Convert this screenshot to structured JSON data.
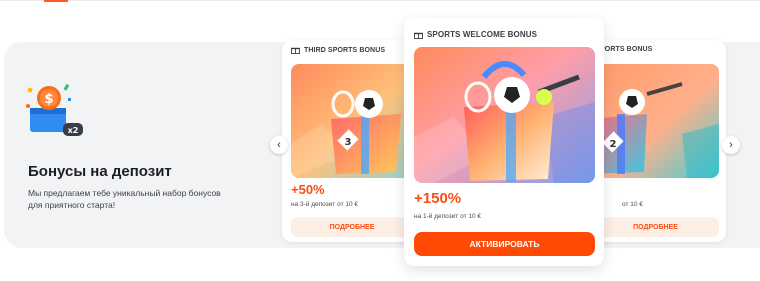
{
  "promo": {
    "title": "Бонусы на депозит",
    "description": "Мы предлагаем тебе уникальный набор бонусов для приятного старта!",
    "icon_badge": "x2",
    "icon": "coin-deposit-icon"
  },
  "cards": {
    "left": {
      "label": "THIRD SPORTS BONUS",
      "amount": "+50%",
      "deposit_text": "на 3-й депозит от 10 €",
      "button": "ПОДРОБНЕЕ",
      "box_number": "3"
    },
    "center": {
      "label": "SPORTS WELCOME BONUS",
      "amount": "+150%",
      "deposit_text": "на 1-й депозит от 10 €",
      "button": "АКТИВИРОВАТЬ"
    },
    "right": {
      "label": "PORTS BONUS",
      "deposit_text": "от 10 €",
      "button": "ПОДРОБНЕЕ",
      "box_number": "2"
    }
  },
  "nav": {
    "prev": "‹",
    "next": "›"
  },
  "colors": {
    "accent": "#ff4a06",
    "amount": "#ff4d12",
    "button_soft_bg": "#fdeee6",
    "band_bg": "#f2f3f5"
  }
}
